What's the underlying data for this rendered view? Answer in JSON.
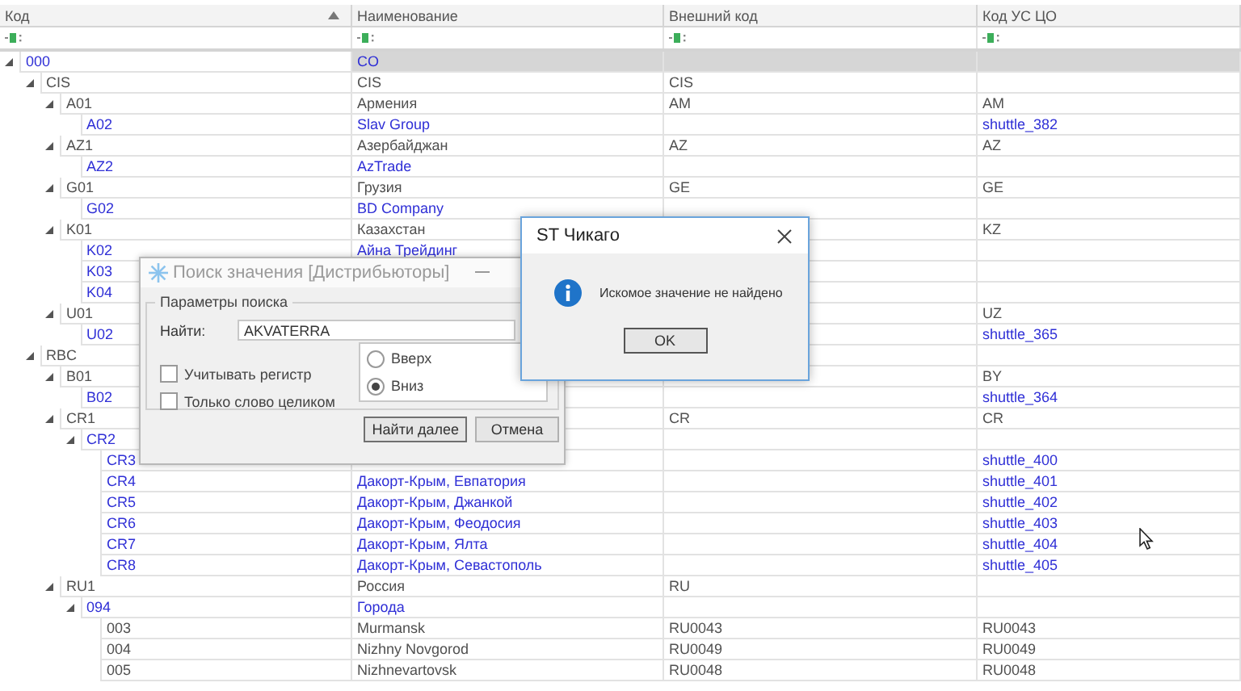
{
  "grid": {
    "columns": [
      {
        "title": "Код",
        "sorted": true
      },
      {
        "title": "Наименование",
        "sorted": false
      },
      {
        "title": "Внешний код",
        "sorted": false
      },
      {
        "title": "Код УС ЦО",
        "sorted": false
      }
    ],
    "rows": [
      {
        "code": "000",
        "name": "CO",
        "selected": true,
        "color": "#2f2fd6",
        "expanded": true,
        "children": [
          {
            "code": "CIS",
            "name": "CIS",
            "external_code": "CIS",
            "selected": false,
            "color": "#505050",
            "expanded": true,
            "children": [
              {
                "code": "A01",
                "name": "Армения",
                "external_code": "AM",
                "us_code": "AM",
                "selected": false,
                "color": "#505050",
                "expanded": true,
                "children": [
                  {
                    "code": "A02",
                    "name": "Slav Group",
                    "us_code": "shuttle_382",
                    "selected": false,
                    "color": "#2f2fd6"
                  }
                ]
              },
              {
                "code": "AZ1",
                "name": "Азербайджан",
                "external_code": "AZ",
                "us_code": "AZ",
                "selected": false,
                "color": "#505050",
                "expanded": true,
                "children": [
                  {
                    "code": "AZ2",
                    "name": "AzTrade",
                    "selected": false,
                    "color": "#2f2fd6"
                  }
                ]
              },
              {
                "code": "G01",
                "name": "Грузия",
                "external_code": "GE",
                "us_code": "GE",
                "selected": false,
                "color": "#505050",
                "expanded": true,
                "children": [
                  {
                    "code": "G02",
                    "name": "BD Company",
                    "selected": false,
                    "color": "#2f2fd6"
                  }
                ]
              },
              {
                "code": "K01",
                "name": "Казахстан",
                "us_code": "KZ",
                "selected": false,
                "color": "#505050",
                "expanded": true,
                "children": [
                  {
                    "code": "K02",
                    "name": "Айна Трейдинг",
                    "selected": false,
                    "color": "#2f2fd6"
                  },
                  {
                    "code": "K03",
                    "selected": false,
                    "color": "#2f2fd6"
                  },
                  {
                    "code": "K04",
                    "selected": false,
                    "color": "#2f2fd6"
                  }
                ]
              },
              {
                "code": "U01",
                "us_code": "UZ",
                "selected": false,
                "color": "#505050",
                "expanded": true,
                "children": [
                  {
                    "code": "U02",
                    "us_code": "shuttle_365",
                    "selected": false,
                    "color": "#2f2fd6"
                  }
                ]
              }
            ]
          },
          {
            "code": "RBC",
            "selected": false,
            "color": "#505050",
            "expanded": true,
            "children": [
              {
                "code": "B01",
                "us_code": "BY",
                "selected": false,
                "color": "#505050",
                "expanded": true,
                "children": [
                  {
                    "code": "B02",
                    "us_code": "shuttle_364",
                    "selected": false,
                    "color": "#2f2fd6"
                  }
                ]
              },
              {
                "code": "CR1",
                "external_code": "CR",
                "us_code": "CR",
                "selected": false,
                "color": "#505050",
                "expanded": true,
                "children": [
                  {
                    "code": "CR2",
                    "selected": false,
                    "color": "#2f2fd6",
                    "expanded": true,
                    "children": [
                      {
                        "code": "CR3",
                        "us_code": "shuttle_400",
                        "selected": false,
                        "color": "#2f2fd6"
                      },
                      {
                        "code": "CR4",
                        "name": "Дакорт-Крым, Евпатория",
                        "us_code": "shuttle_401",
                        "selected": false,
                        "color": "#2f2fd6"
                      },
                      {
                        "code": "CR5",
                        "name": "Дакорт-Крым, Джанкой",
                        "us_code": "shuttle_402",
                        "selected": false,
                        "color": "#2f2fd6"
                      },
                      {
                        "code": "CR6",
                        "name": "Дакорт-Крым, Феодосия",
                        "us_code": "shuttle_403",
                        "selected": false,
                        "color": "#2f2fd6"
                      },
                      {
                        "code": "CR7",
                        "name": "Дакорт-Крым, Ялта",
                        "us_code": "shuttle_404",
                        "selected": false,
                        "color": "#2f2fd6"
                      },
                      {
                        "code": "CR8",
                        "name": "Дакорт-Крым, Севастополь",
                        "us_code": "shuttle_405",
                        "selected": false,
                        "color": "#2f2fd6"
                      }
                    ]
                  }
                ]
              },
              {
                "code": "RU1",
                "name": "Россия",
                "external_code": "RU",
                "selected": false,
                "color": "#505050",
                "expanded": true,
                "children": [
                  {
                    "code": "094",
                    "name": "Города",
                    "selected": false,
                    "color": "#2f2fd6",
                    "expanded": true,
                    "children": [
                      {
                        "code": "003",
                        "name": "Murmansk",
                        "external_code": "RU0043",
                        "us_code": "RU0043",
                        "selected": false,
                        "color": "#505050"
                      },
                      {
                        "code": "004",
                        "name": "Nizhny Novgorod",
                        "external_code": "RU0049",
                        "us_code": "RU0049",
                        "selected": false,
                        "color": "#505050"
                      },
                      {
                        "code": "005",
                        "name": "Nizhnevartovsk",
                        "external_code": "RU0048",
                        "us_code": "RU0048",
                        "selected": false,
                        "color": "#505050"
                      }
                    ]
                  }
                ]
              }
            ]
          }
        ]
      }
    ]
  },
  "search_dialog": {
    "title": "Поиск значения [Дистрибьюторы]",
    "group_title": "Параметры поиска",
    "find_label": "Найти:",
    "find_value": "AKVATERRA",
    "options": [
      {
        "label": "Учитывать регистр",
        "checked": false
      },
      {
        "label": "Только слово целиком",
        "checked": false
      }
    ],
    "directions": [
      {
        "label": "Вверх",
        "selected": false
      },
      {
        "label": "Вниз",
        "selected": true
      }
    ],
    "buttons": [
      "Найти далее",
      "Отмена"
    ]
  },
  "message_box": {
    "title": "ST Чикаго",
    "message": "Искомое значение не найдено",
    "buttons": [
      "OK"
    ]
  }
}
